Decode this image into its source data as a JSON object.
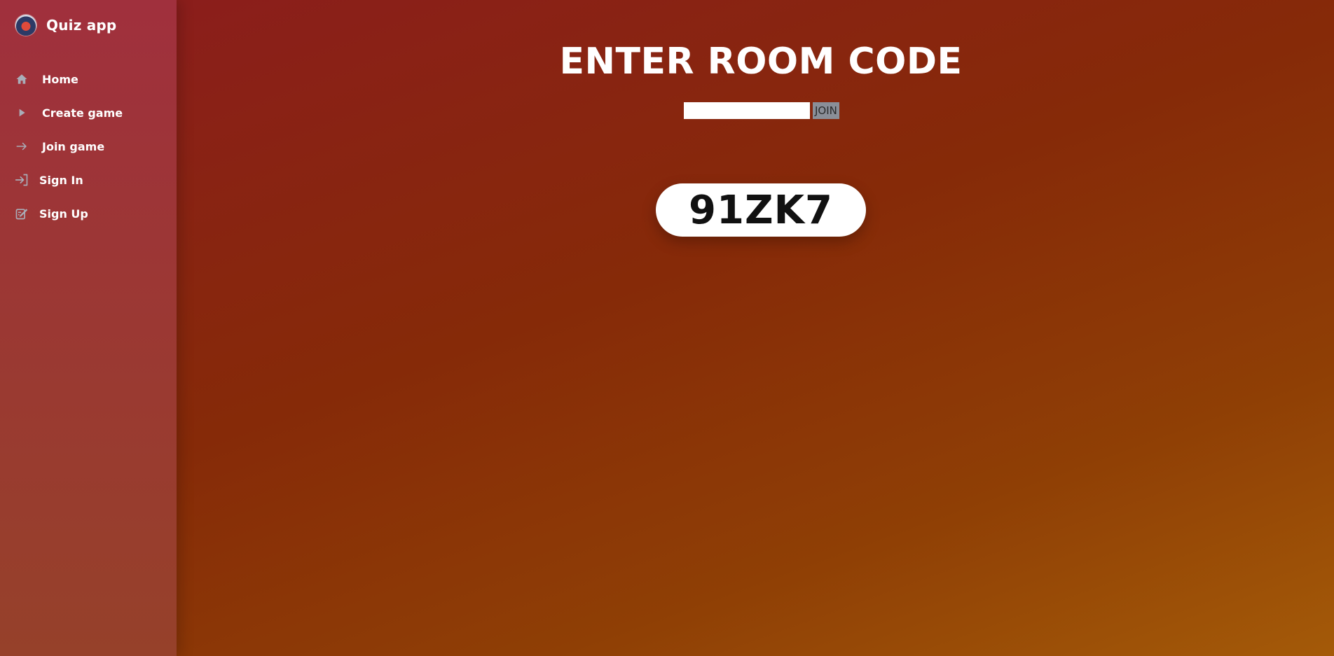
{
  "app": {
    "title": "Quiz app"
  },
  "sidebar": {
    "items": [
      {
        "label": "Home",
        "icon": "home-icon"
      },
      {
        "label": "Create game",
        "icon": "play-icon"
      },
      {
        "label": "Join game",
        "icon": "arrow-right-icon"
      },
      {
        "label": "Sign In",
        "icon": "sign-in-icon"
      },
      {
        "label": "Sign Up",
        "icon": "sign-up-icon"
      }
    ]
  },
  "main": {
    "title": "ENTER ROOM CODE",
    "code_input": {
      "value": "",
      "placeholder": ""
    },
    "join_label": "JOIN",
    "room_code": "91ZK7"
  },
  "colors": {
    "sidebar": "#a0303d",
    "background_start": "#8c1c1e",
    "background_end": "#a45a08",
    "join_button": "#8a8f98"
  }
}
